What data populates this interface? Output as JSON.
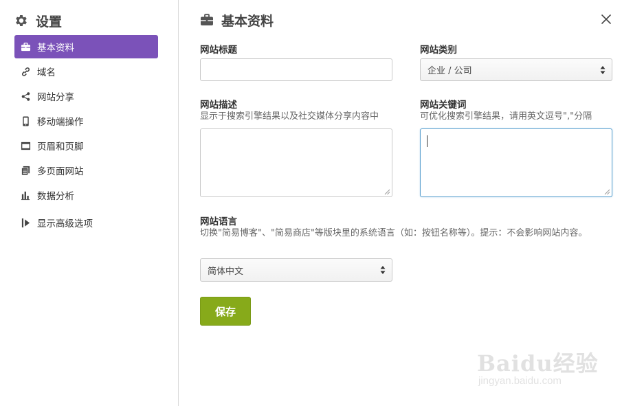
{
  "sidebar": {
    "title": "设置",
    "icon": "gear-icon",
    "items": [
      {
        "label": "基本资料",
        "icon": "briefcase-icon",
        "active": true
      },
      {
        "label": "域名",
        "icon": "link-icon"
      },
      {
        "label": "网站分享",
        "icon": "share-icon"
      },
      {
        "label": "移动端操作",
        "icon": "mobile-icon"
      },
      {
        "label": "页眉和页脚",
        "icon": "header-footer-icon"
      },
      {
        "label": "多页面网站",
        "icon": "pages-icon"
      },
      {
        "label": "数据分析",
        "icon": "bar-chart-icon"
      },
      {
        "label": "显示高级选项",
        "icon": "expand-icon"
      }
    ]
  },
  "panel": {
    "title": "基本资料",
    "icon": "briefcase-icon",
    "close_icon": "close-icon"
  },
  "form": {
    "site_title": {
      "label": "网站标题",
      "value": ""
    },
    "site_category": {
      "label": "网站类别",
      "selected": "企业 / 公司"
    },
    "site_description": {
      "label": "网站描述",
      "help": "显示于搜索引擎结果以及社交媒体分享内容中",
      "value": ""
    },
    "site_keywords": {
      "label": "网站关键词",
      "help": "可优化搜索引擎结果，请用英文逗号\",\"分隔",
      "value": ""
    },
    "site_language": {
      "label": "网站语言",
      "help": "切换\"简易博客\"、\"简易商店\"等版块里的系统语言（如：按钮名称等）。提示：不会影响网站内容。",
      "selected": "简体中文"
    },
    "save_label": "保存"
  },
  "watermark": {
    "brand": "Baidu经验",
    "url": "jingyan.baidu.com"
  },
  "colors": {
    "accent": "#7b52b9",
    "save": "#87aa1a",
    "focus": "#5aa0cf"
  }
}
